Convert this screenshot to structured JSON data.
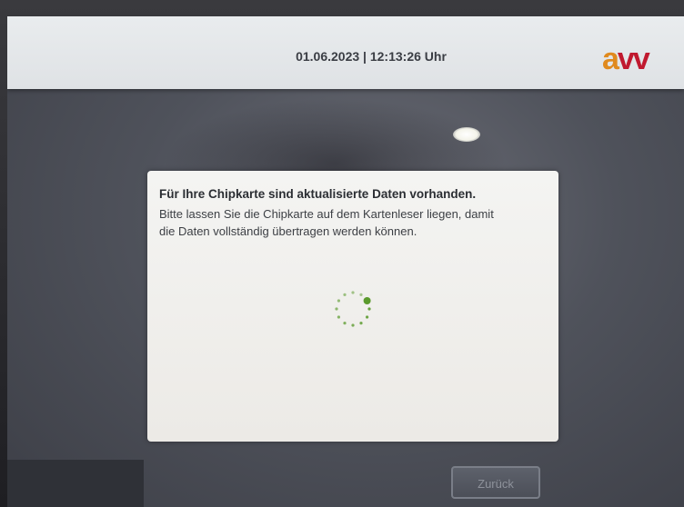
{
  "header": {
    "datetime": "01.06.2023 | 12:13:26 Uhr",
    "logo": {
      "part1": "a",
      "part2": "vv"
    }
  },
  "dialog": {
    "title": "Für Ihre Chipkarte sind aktualisierte Daten vorhanden.",
    "message_line1": "Bitte lassen Sie die Chipkarte auf dem Kartenleser liegen, damit",
    "message_line2": "die Daten vollständig übertragen werden können.",
    "loading_indicator": "loading-spinner"
  },
  "footer": {
    "back_label": "Zurück"
  },
  "colors": {
    "spinner": "#5a9a2c",
    "logo_a": "#e08a1e",
    "logo_vv": "#c0192f"
  }
}
